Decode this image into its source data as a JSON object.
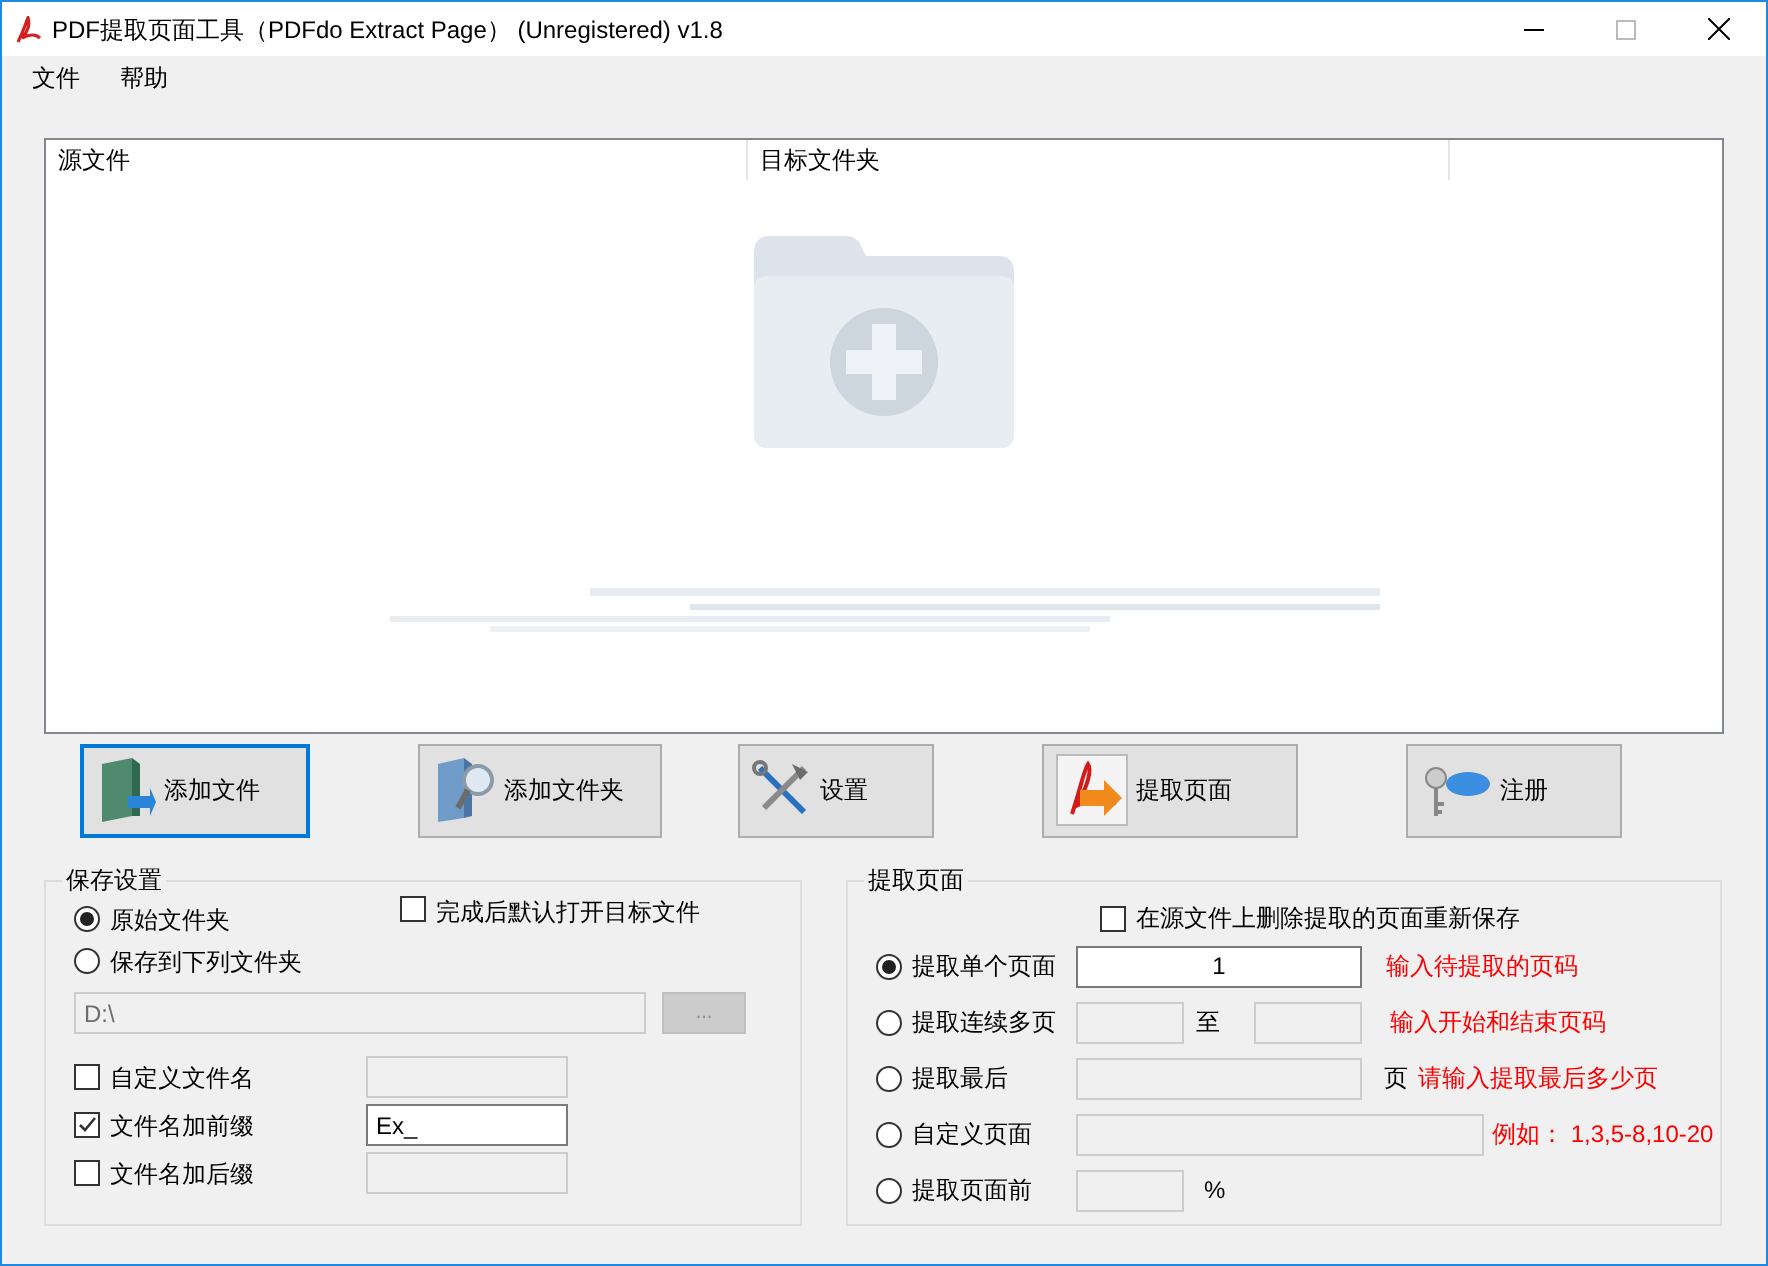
{
  "window": {
    "title": "PDF提取页面工具（PDFdo Extract Page） (Unregistered) v1.8"
  },
  "menu": [
    "文件",
    "帮助"
  ],
  "file_list": {
    "columns": [
      "源文件",
      "目标文件夹"
    ]
  },
  "buttons": [
    {
      "kind": "add-file",
      "label": "添加文件",
      "selected": true
    },
    {
      "kind": "add-folder",
      "label": "添加文件夹",
      "selected": false
    },
    {
      "kind": "settings",
      "label": "设置",
      "selected": false
    },
    {
      "kind": "extract",
      "label": "提取页面",
      "selected": false
    },
    {
      "kind": "register",
      "label": "注册",
      "selected": false
    }
  ],
  "save_settings": {
    "title": "保存设置",
    "locations": [
      {
        "label": "原始文件夹",
        "selected": true
      },
      {
        "label": "保存到下列文件夹",
        "selected": false
      }
    ],
    "open_after": {
      "label": "完成后默认打开目标文件",
      "checked": false
    },
    "folder_path": "D:\\",
    "browse": "...",
    "name_options": [
      {
        "label": "自定义文件名",
        "checked": false
      },
      {
        "label": "文件名加前缀",
        "checked": true,
        "value": "Ex_"
      },
      {
        "label": "文件名加后缀",
        "checked": false
      }
    ]
  },
  "extract": {
    "title": "提取页面",
    "delete_from_source": {
      "label": "在源文件上删除提取的页面重新保存",
      "checked": false
    },
    "modes": [
      {
        "kind": "single",
        "label": "提取单个页面",
        "selected": true,
        "value": "1",
        "hint": "输入待提取的页码"
      },
      {
        "kind": "range",
        "label": "提取连续多页",
        "selected": false,
        "between": "至",
        "hint": "输入开始和结束页码"
      },
      {
        "kind": "last",
        "label": "提取最后",
        "selected": false,
        "unit": "页",
        "hint": "请输入提取最后多少页"
      },
      {
        "kind": "custom",
        "label": "自定义页面",
        "selected": false,
        "hint": "例如： 1,3,5-8,10-20"
      },
      {
        "kind": "percent",
        "label": "提取页面前",
        "selected": false,
        "unit": "%"
      }
    ]
  }
}
